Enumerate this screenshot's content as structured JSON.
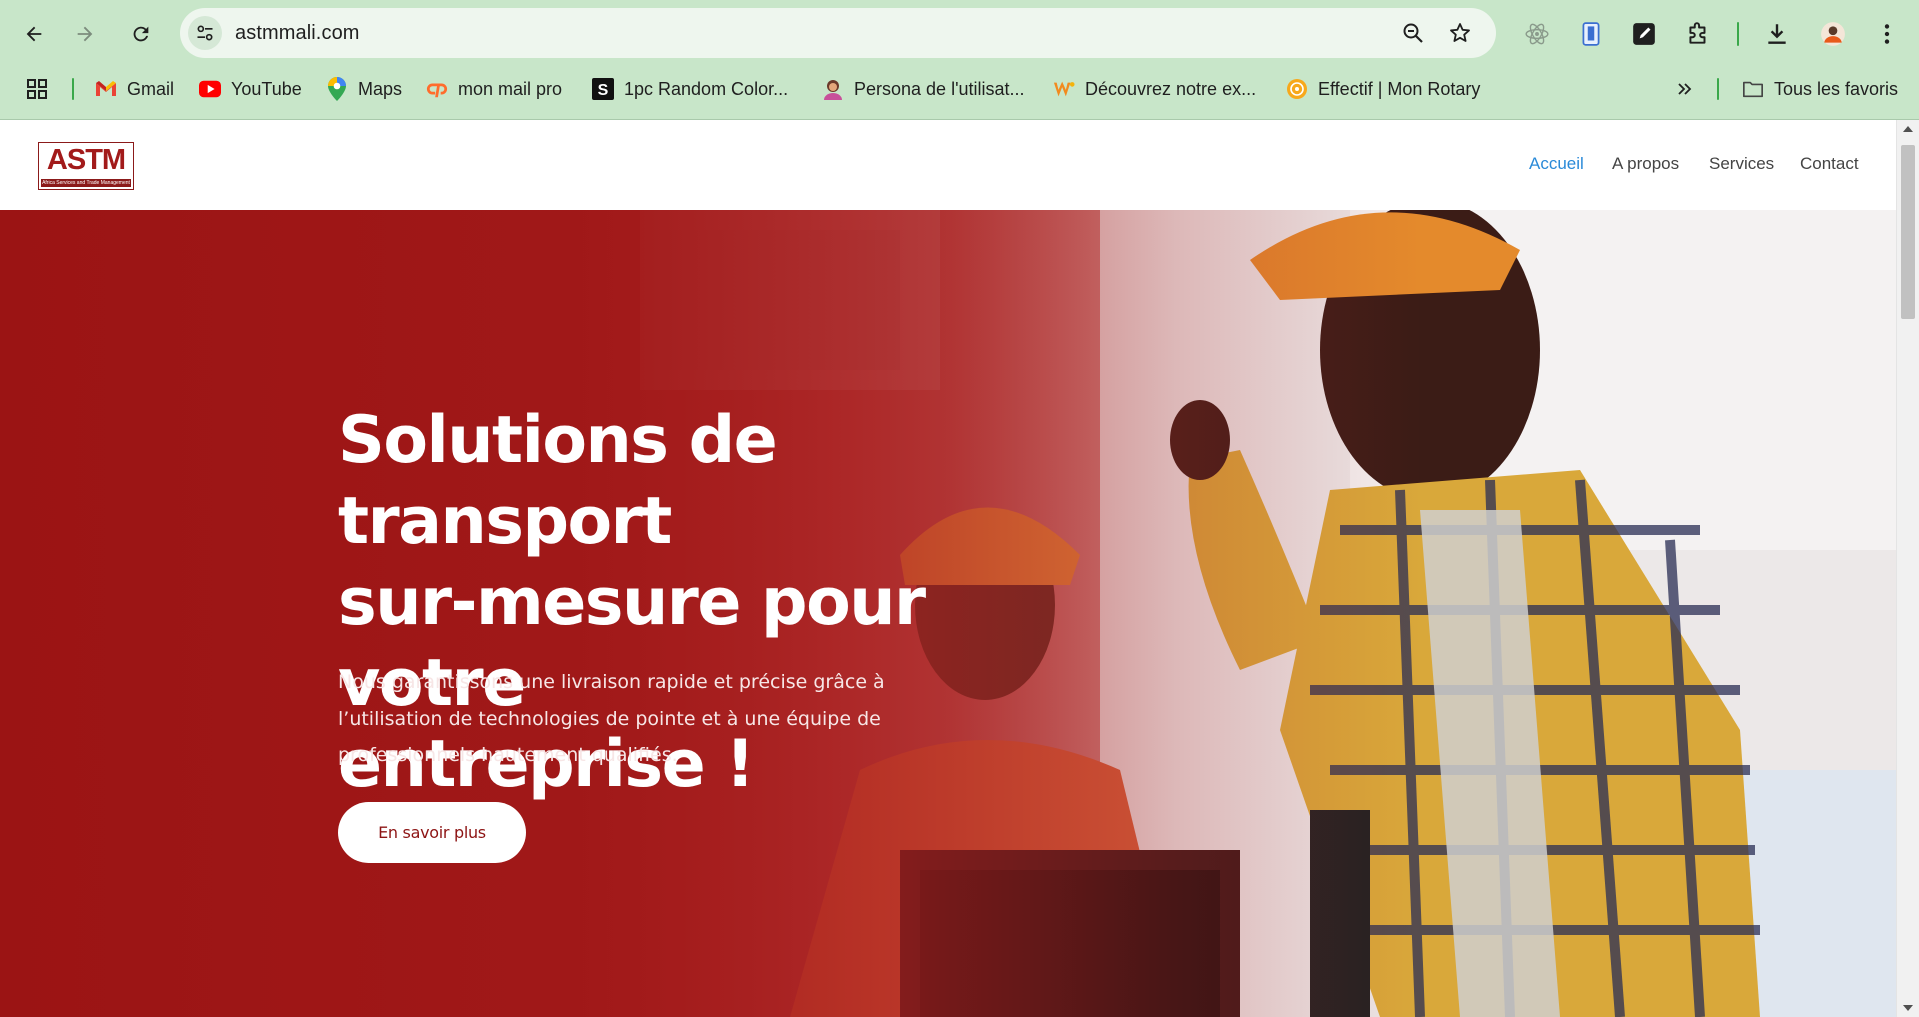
{
  "browser": {
    "url": "astmmali.com",
    "bookmarks": [
      {
        "label": "Gmail",
        "icon": "gmail-icon"
      },
      {
        "label": "YouTube",
        "icon": "youtube-icon"
      },
      {
        "label": "Maps",
        "icon": "maps-icon"
      },
      {
        "label": "mon mail pro",
        "icon": "cpanel-icon"
      },
      {
        "label": "1pc Random Color...",
        "icon": "s-square-icon"
      },
      {
        "label": "Persona de l'utilisat...",
        "icon": "persona-icon"
      },
      {
        "label": "Découvrez notre ex...",
        "icon": "w-logo-icon"
      },
      {
        "label": "Effectif | Mon Rotary",
        "icon": "rotary-icon"
      }
    ],
    "all_bookmarks_label": "Tous les favoris"
  },
  "site": {
    "logo_text": "ASTM",
    "logo_subtext": "Africa Services and Trade Management",
    "nav": [
      {
        "label": "Accueil",
        "active": true
      },
      {
        "label": "A propos",
        "active": false
      },
      {
        "label": "Services",
        "active": false
      },
      {
        "label": "Contact",
        "active": false
      }
    ]
  },
  "hero": {
    "title_line1": "Solutions de transport",
    "title_line2": "sur-mesure pour votre",
    "title_line3": "entreprise !",
    "text_line1": "Nous garantissons une livraison rapide et précise grâce à",
    "text_line2": "l’utilisation de technologies de pointe et à une équipe de",
    "text_line3": "professionnels hautement qualifiés.",
    "button_label": "En savoir plus"
  },
  "colors": {
    "brand_red": "#9c1616",
    "nav_active": "#2a8ad8",
    "chrome_green": "#c8e6c9"
  }
}
